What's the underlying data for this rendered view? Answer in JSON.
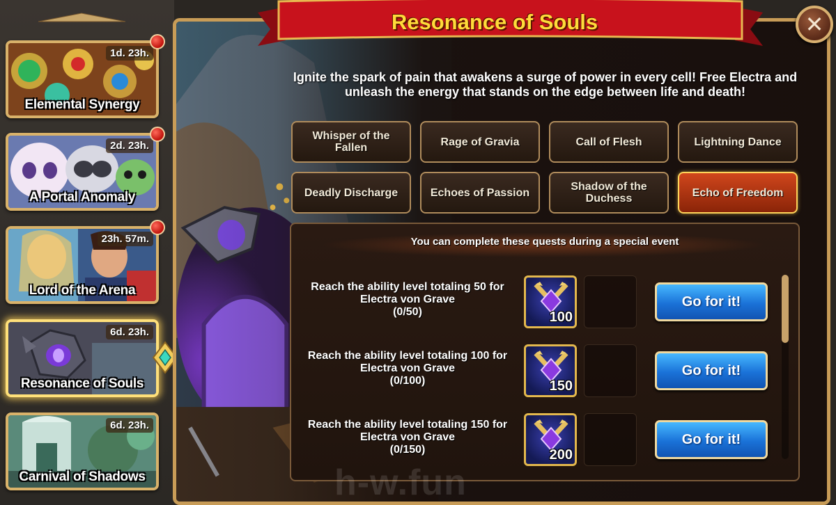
{
  "sidebar": {
    "events": [
      {
        "name": "Elemental Synergy",
        "timer": "1d. 23h.",
        "notification": true,
        "active": false
      },
      {
        "name": "A Portal Anomaly",
        "timer": "2d. 23h.",
        "notification": true,
        "active": false
      },
      {
        "name": "Lord of the Arena",
        "timer": "23h. 57m.",
        "notification": true,
        "active": false
      },
      {
        "name": "Resonance of Souls",
        "timer": "6d. 23h.",
        "notification": false,
        "active": true
      },
      {
        "name": "Carnival of Shadows",
        "timer": "6d. 23h.",
        "notification": false,
        "active": false
      }
    ]
  },
  "panel": {
    "title": "Resonance of Souls",
    "close_icon": "close-icon",
    "description": "Ignite the spark of pain that awakens a surge of power in every cell! Free Electra and unleash the energy that stands on the edge between life and death!",
    "tabs": [
      {
        "label": "Whisper of the Fallen",
        "active": false
      },
      {
        "label": "Rage of Gravia",
        "active": false
      },
      {
        "label": "Call of Flesh",
        "active": false
      },
      {
        "label": "Lightning Dance",
        "active": false
      },
      {
        "label": "Deadly Discharge",
        "active": false
      },
      {
        "label": "Echoes of Passion",
        "active": false
      },
      {
        "label": "Shadow of the Duchess",
        "active": false
      },
      {
        "label": "Echo of Freedom",
        "active": true
      }
    ],
    "quests_header": "You can complete these quests during a special event",
    "quests": [
      {
        "text": "Reach the ability level totaling 50 for Electra von Grave",
        "progress": "(0/50)",
        "reward_amount": "100",
        "reward_icon": "crossed-axes-gem-icon",
        "button": "Go for it!"
      },
      {
        "text": "Reach the ability level totaling 100 for Electra von Grave",
        "progress": "(0/100)",
        "reward_amount": "150",
        "reward_icon": "crossed-axes-gem-icon",
        "button": "Go for it!"
      },
      {
        "text": "Reach the ability level totaling 150 for Electra von Grave",
        "progress": "(0/150)",
        "reward_amount": "200",
        "reward_icon": "crossed-axes-gem-icon",
        "button": "Go for it!"
      }
    ],
    "watermark": "h-w.fun"
  },
  "colors": {
    "title_text": "#ffdb3a",
    "banner_red": "#c0121c",
    "frame_gold": "#c89c57",
    "button_blue": "#1a72d8",
    "active_tab": "#c0401a"
  }
}
